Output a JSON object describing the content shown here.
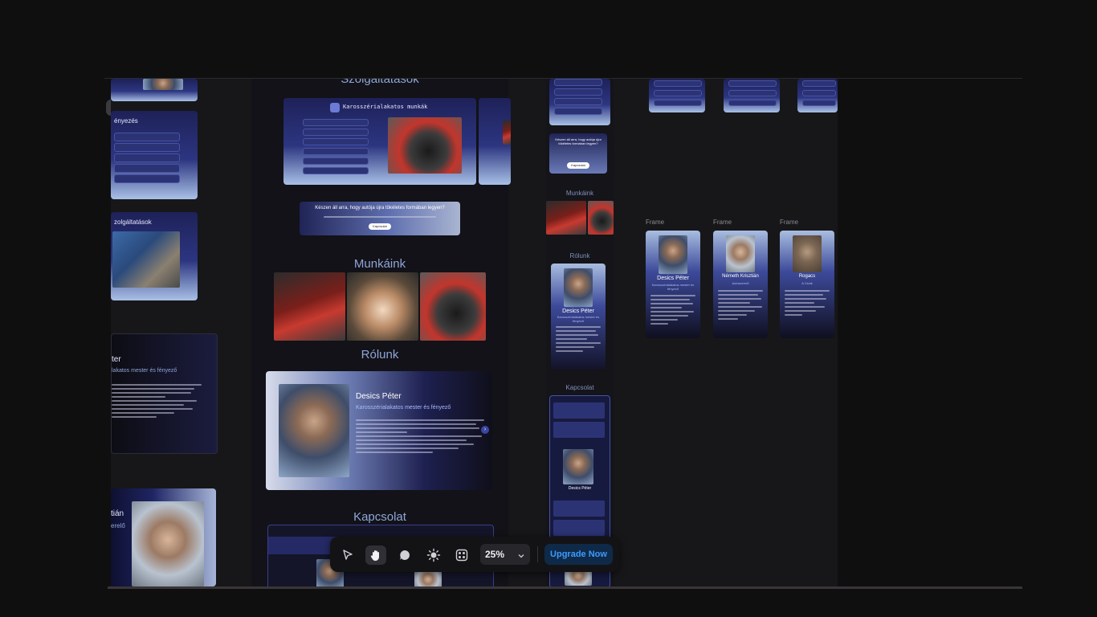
{
  "toolbar_top": {
    "status_badge": ""
  },
  "canvas": {
    "left_column": {
      "partial_heading_1": "ényezés",
      "partial_heading_2": "zolgáltatások",
      "partial_name": "ter",
      "partial_role": "lakatos mester és fényező",
      "partial_name_2": "tián",
      "partial_role_2": "erelő"
    },
    "main_frame": {
      "services_title": "Szolgáltatások",
      "service_card_title": "Karosszérialakatos munkák",
      "cta_title": "Készen áll arra, hogy autója újra tökéletes formában legyen?",
      "cta_button": "Kapcsolat",
      "works_title": "Munkáink",
      "about_title": "Rólunk",
      "person_name": "Desics Péter",
      "person_role": "Karosszérialakatos mester és fényező",
      "contact_title": "Kapcsolat"
    },
    "mobile_frame": {
      "cta_text": "Készen áll arra, hogy autója újra tökéletes formában legyen?",
      "cta_button": "Kapcsolat",
      "works_title": "Munkáink",
      "about_title": "Rólunk",
      "person_name": "Desics Péter",
      "person_role": "Karosszérialakatos mester és fényező",
      "contact_title": "Kapcsolat",
      "contact_name": "Desics Péter"
    },
    "frames": [
      {
        "label": "Frame",
        "name": "Desics Péter",
        "role": "Karosszérialakatos mester és fényező"
      },
      {
        "label": "Frame",
        "name": "Németh Krisztián",
        "role": "Autószerelő"
      },
      {
        "label": "Frame",
        "name": "Rogacs",
        "role": "A Cicák"
      }
    ]
  },
  "bottom_toolbar": {
    "zoom": "25%",
    "upgrade_label": "Upgrade Now",
    "icons": [
      "cursor-icon",
      "hand-icon",
      "comment-icon",
      "sun-icon",
      "components-icon"
    ]
  },
  "colors": {
    "accent": "#1e7bff",
    "upgrade_text": "#3d9bff"
  }
}
